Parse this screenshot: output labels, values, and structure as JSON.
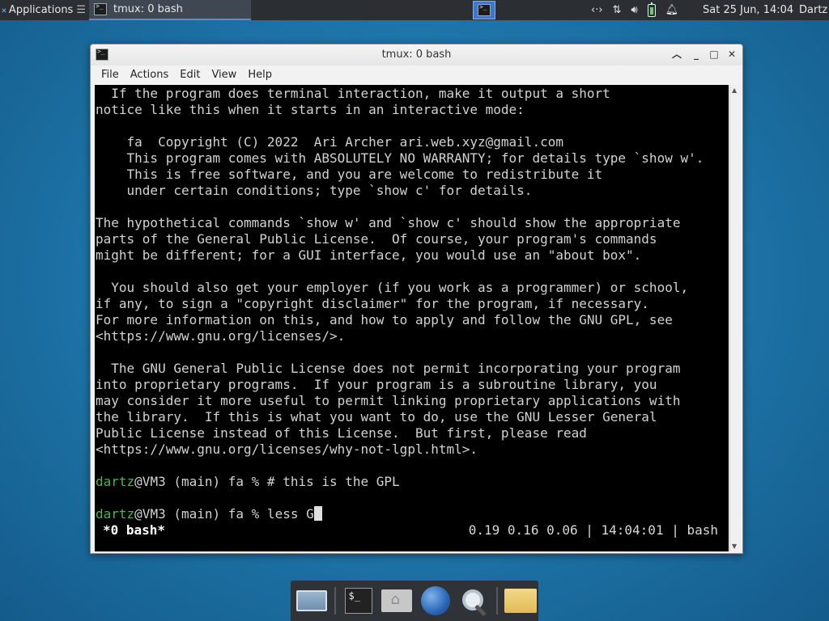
{
  "top_panel": {
    "apps_label": "Applications",
    "apps_suffix": "☰",
    "task_title": "tmux: 0 bash",
    "clock": "Sat 25 Jun, 14:04",
    "user": "Dartz",
    "tray_icons": [
      "network-arrows-icon",
      "transfer-icon",
      "volume-icon",
      "battery-icon",
      "bell-icon"
    ]
  },
  "window": {
    "title": "tmux: 0 bash",
    "menu": [
      "File",
      "Actions",
      "Edit",
      "View",
      "Help"
    ]
  },
  "terminal": {
    "lines": [
      "  If the program does terminal interaction, make it output a short",
      "notice like this when it starts in an interactive mode:",
      "",
      "    fa  Copyright (C) 2022  Ari Archer ari.web.xyz@gmail.com",
      "    This program comes with ABSOLUTELY NO WARRANTY; for details type `show w'.",
      "    This is free software, and you are welcome to redistribute it",
      "    under certain conditions; type `show c' for details.",
      "",
      "The hypothetical commands `show w' and `show c' should show the appropriate",
      "parts of the General Public License.  Of course, your program's commands",
      "might be different; for a GUI interface, you would use an \"about box\".",
      "",
      "  You should also get your employer (if you work as a programmer) or school,",
      "if any, to sign a \"copyright disclaimer\" for the program, if necessary.",
      "For more information on this, and how to apply and follow the GNU GPL, see",
      "<https://www.gnu.org/licenses/>.",
      "",
      "  The GNU General Public License does not permit incorporating your program",
      "into proprietary programs.  If your program is a subroutine library, you",
      "may consider it more useful to permit linking proprietary applications with",
      "the library.  If this is what you want to do, use the GNU Lesser General",
      "Public License instead of this License.  But first, please read",
      "<https://www.gnu.org/licenses/why-not-lgpl.html>.",
      ""
    ],
    "prompt1_user": "dartz",
    "prompt1_rest": "@VM3 (main) fa % # this is the GPL",
    "prompt2_user": "dartz",
    "prompt2_rest": "@VM3 (main) fa % less G",
    "status_left": "*0 bash*",
    "status_right": "0.19 0.16 0.06 | 14:04:01 | bash"
  },
  "colors": {
    "prompt_user": "#4eb34e",
    "terminal_bg": "#000000",
    "panel_bg": "#2b2e33"
  },
  "dock": {
    "items": [
      "desktop-icon",
      "terminal-icon",
      "home-folder-icon",
      "web-browser-icon",
      "search-icon",
      "folder-icon"
    ],
    "terminal_glyph": "$_"
  }
}
